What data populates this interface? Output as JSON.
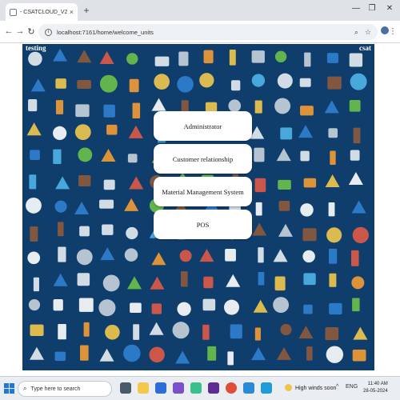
{
  "browser": {
    "tab_title": "- CSATCLOUD_V2",
    "tab_close": "×",
    "new_tab": "+",
    "url": "localhost:7161/home/welcome_units",
    "window_controls": {
      "minimize": "—",
      "restore": "❐",
      "close": "✕"
    }
  },
  "page": {
    "corner_left": "testing",
    "corner_right": "csat"
  },
  "menu": {
    "items": [
      {
        "label": "Administrator"
      },
      {
        "label": "Customer relationship"
      },
      {
        "label": "Material Management System"
      },
      {
        "label": "POS"
      }
    ]
  },
  "taskbar": {
    "search_placeholder": "Type here to search",
    "weather": "High winds soon",
    "language": "ENG",
    "time": "11:40 AM",
    "date": "28-05-2024"
  },
  "colors": {
    "hero_bg": "#103e6c",
    "tab_bar": "#dfe3e8",
    "taskbar": "#eaeef3"
  }
}
